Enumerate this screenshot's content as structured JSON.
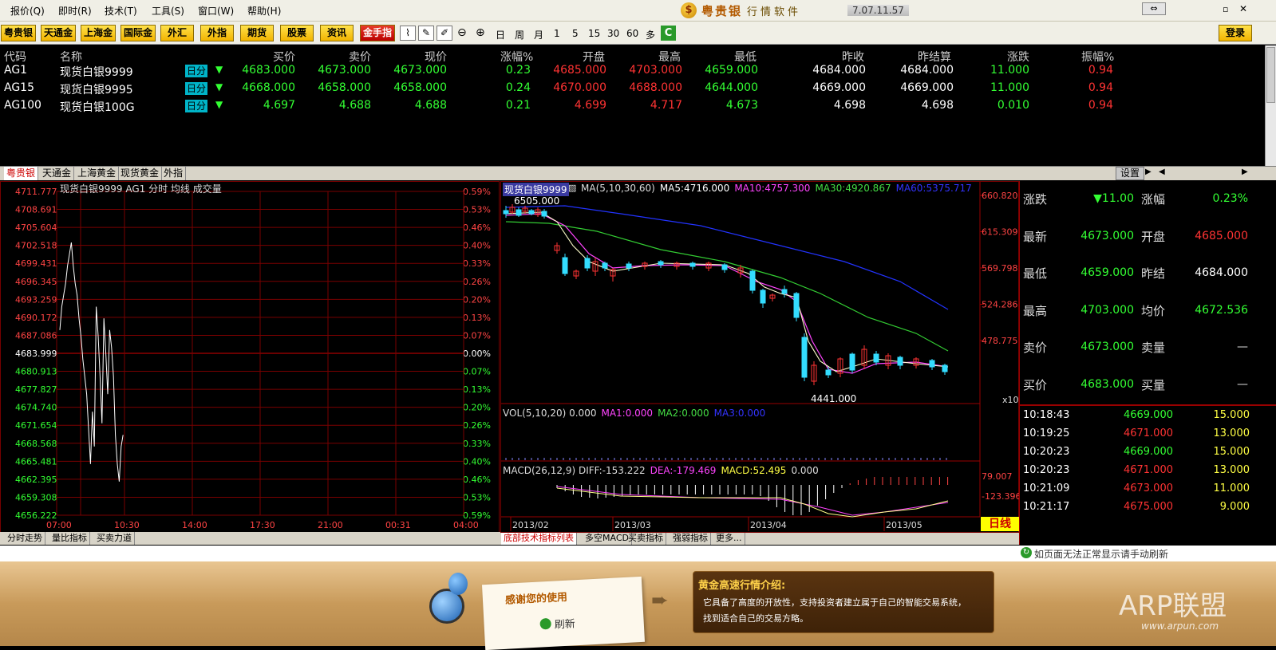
{
  "menu": [
    "报价(Q)",
    "即时(R)",
    "技术(T)",
    "工具(S)",
    "窗口(W)",
    "帮助(H)"
  ],
  "brand": {
    "name": "粤贵银",
    "sub": "行情软件",
    "version": "7.07.11.57"
  },
  "window_buttons": [
    "⇔",
    "▫",
    "✕"
  ],
  "toolbar": {
    "markets": [
      "粤贵银",
      "天通金",
      "上海金",
      "国际金",
      "外汇",
      "外指",
      "期货",
      "股票",
      "资讯"
    ],
    "special": "金手指",
    "periods": [
      "日",
      "周",
      "月",
      "1",
      "5",
      "15",
      "30",
      "60",
      "多"
    ],
    "login": "登录"
  },
  "quote_table": {
    "headers": [
      "代码",
      "名称",
      "买价",
      "卖价",
      "现价",
      "涨幅%",
      "开盘",
      "最高",
      "最低",
      "昨收",
      "昨结算",
      "涨跌",
      "振幅%"
    ],
    "rows": [
      {
        "code": "AG1",
        "name": "现货白银9999",
        "tag": "日分",
        "arrow": "▼",
        "buy": "4683.000",
        "sell": "4673.000",
        "price": "4673.000",
        "pct": "0.23",
        "open": "4685.000",
        "high": "4703.000",
        "low": "4659.000",
        "prev_close": "4684.000",
        "prev_settle": "4684.000",
        "change": "11.000",
        "amp": "0.94"
      },
      {
        "code": "AG15",
        "name": "现货白银9995",
        "tag": "日分",
        "arrow": "▼",
        "buy": "4668.000",
        "sell": "4658.000",
        "price": "4658.000",
        "pct": "0.24",
        "open": "4670.000",
        "high": "4688.000",
        "low": "4644.000",
        "prev_close": "4669.000",
        "prev_settle": "4669.000",
        "change": "11.000",
        "amp": "0.94"
      },
      {
        "code": "AG100",
        "name": "现货白银100G",
        "tag": "日分",
        "arrow": "▼",
        "buy": "4.697",
        "sell": "4.688",
        "price": "4.688",
        "pct": "0.21",
        "open": "4.699",
        "high": "4.717",
        "low": "4.673",
        "prev_close": "4.698",
        "prev_settle": "4.698",
        "change": "0.010",
        "amp": "0.94"
      }
    ]
  },
  "market_tabs": [
    "粤贵银",
    "天通金",
    "上海黄金",
    "现货黄金",
    "外指"
  ],
  "settings_label": "设置",
  "intraday": {
    "title": "现货白银9999 AG1 分时 均线 成交量",
    "price_ticks": [
      "4711.777",
      "4708.691",
      "4705.604",
      "4702.518",
      "4699.431",
      "4696.345",
      "4693.259",
      "4690.172",
      "4687.086",
      "4683.999",
      "4680.913",
      "4677.827",
      "4674.740",
      "4671.654",
      "4668.568",
      "4665.481",
      "4662.395",
      "4659.308",
      "4656.222"
    ],
    "pct_ticks": [
      "0.59%",
      "0.53%",
      "0.46%",
      "0.40%",
      "0.33%",
      "0.26%",
      "0.20%",
      "0.13%",
      "0.07%",
      "0.00%",
      "0.07%",
      "0.13%",
      "0.20%",
      "0.26%",
      "0.33%",
      "0.40%",
      "0.46%",
      "0.53%",
      "0.59%"
    ],
    "time_ticks": [
      "07:00",
      "10:30",
      "14:00",
      "17:30",
      "21:00",
      "00:31",
      "04:00"
    ],
    "bottom_tabs": [
      "分时走势",
      "量比指标",
      "买卖力道"
    ]
  },
  "kline": {
    "title": "现货白银9999",
    "ma_legend": [
      {
        "text": "MA(5,10,30,60)",
        "color": "#dddddd"
      },
      {
        "text": "MA5:4716.000",
        "color": "#ffffff"
      },
      {
        "text": "MA10:4757.300",
        "color": "#ff44ff"
      },
      {
        "text": "MA30:4920.867",
        "color": "#44dd44"
      },
      {
        "text": "MA60:5375.717",
        "color": "#3333ff"
      }
    ],
    "right_ticks": [
      "660.820",
      "615.309",
      "569.798",
      "524.286",
      "478.775"
    ],
    "multiplier": "x10",
    "high_label": "6505.000",
    "low_label": "4441.000",
    "vol_legend": [
      {
        "text": "VOL(5,10,20) 0.000",
        "color": "#dddddd"
      },
      {
        "text": "MA1:0.000",
        "color": "#ff44ff"
      },
      {
        "text": "MA2:0.000",
        "color": "#44dd44"
      },
      {
        "text": "MA3:0.000",
        "color": "#3333ff"
      }
    ],
    "macd_legend": [
      {
        "text": "MACD(26,12,9) DIFF:-153.222",
        "color": "#dddddd"
      },
      {
        "text": "DEA:-179.469",
        "color": "#ff44ff"
      },
      {
        "text": "MACD:52.495",
        "color": "#ffff44"
      },
      {
        "text": "0.000",
        "color": "#dddddd"
      }
    ],
    "macd_ticks": [
      "79.007",
      "-123.396"
    ],
    "date_ticks": [
      "2013/02",
      "2013/03",
      "2013/04",
      "2013/05"
    ],
    "period_badge": "日线",
    "bottom_tabs": [
      "底部技术指标列表",
      "多空MACD",
      "买卖指标",
      "强弱指标",
      "更多..."
    ]
  },
  "summary": [
    {
      "l1": "涨跌",
      "v1": "▼11.00",
      "c1": "#33ff33",
      "l2": "涨幅",
      "v2": "0.23%",
      "c2": "#33ff33"
    },
    {
      "l1": "最新",
      "v1": "4673.000",
      "c1": "#33ff33",
      "l2": "开盘",
      "v2": "4685.000",
      "c2": "#ff3333"
    },
    {
      "l1": "最低",
      "v1": "4659.000",
      "c1": "#33ff33",
      "l2": "昨结",
      "v2": "4684.000",
      "c2": "#ffffff"
    },
    {
      "l1": "最高",
      "v1": "4703.000",
      "c1": "#33ff33",
      "l2": "均价",
      "v2": "4672.536",
      "c2": "#33ff33"
    },
    {
      "l1": "卖价",
      "v1": "4673.000",
      "c1": "#33ff33",
      "l2": "卖量",
      "v2": "—",
      "c2": "#dddddd"
    },
    {
      "l1": "买价",
      "v1": "4683.000",
      "c1": "#33ff33",
      "l2": "买量",
      "v2": "—",
      "c2": "#dddddd"
    }
  ],
  "ticks": [
    {
      "time": "10:18:43",
      "price": "4669.000",
      "vol": "15.000",
      "c": "#33ff33"
    },
    {
      "time": "10:19:25",
      "price": "4671.000",
      "vol": "13.000",
      "c": "#ff3333"
    },
    {
      "time": "10:20:23",
      "price": "4669.000",
      "vol": "15.000",
      "c": "#33ff33"
    },
    {
      "time": "10:20:23",
      "price": "4671.000",
      "vol": "13.000",
      "c": "#ff3333"
    },
    {
      "time": "10:21:09",
      "price": "4673.000",
      "vol": "11.000",
      "c": "#ff3333"
    },
    {
      "time": "10:21:17",
      "price": "4675.000",
      "vol": "9.000",
      "c": "#ff3333"
    }
  ],
  "refresh_notice": "如页面无法正常显示请手动刷新",
  "ad": {
    "thanks": "感谢您的使用",
    "refresh": "刷新",
    "headline": "黄金高速行情介绍:",
    "line1": "它具备了高度的开放性，支持投资者建立属于自己的智能交易系统，",
    "line2": "找到适合自己的交易方略。",
    "watermark": "ARP联盟",
    "watermark_url": "www.arpun.com"
  }
}
